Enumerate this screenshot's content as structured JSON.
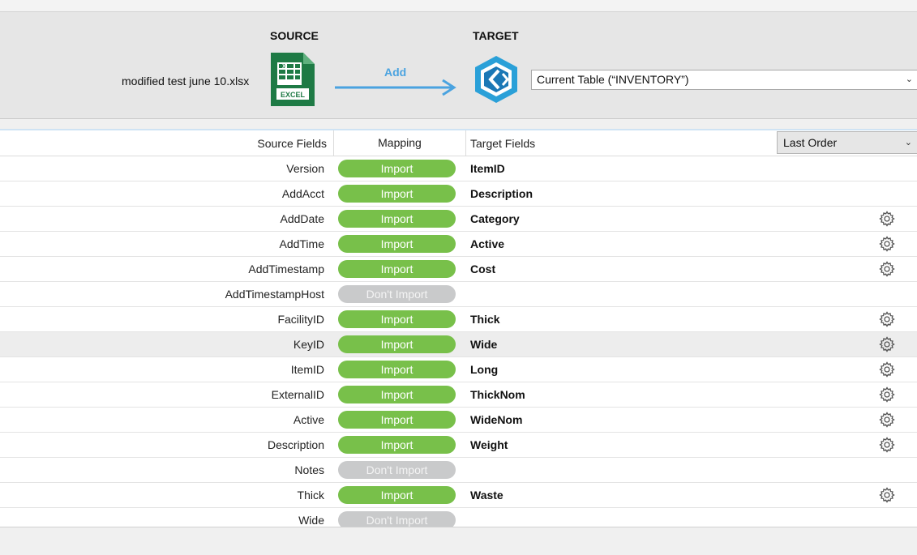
{
  "header": {
    "source_label": "SOURCE",
    "target_label": "TARGET",
    "source_file": "modified test june 10.xlsx",
    "excel_badge": "EXCEL",
    "action_label": "Add",
    "target_table": "Current Table (“INVENTORY”)"
  },
  "columns": {
    "source": "Source Fields",
    "mapping": "Mapping",
    "target": "Target Fields",
    "order": "Last Order"
  },
  "rows": [
    {
      "source": "Version",
      "mapping": "Import",
      "target": "ItemID",
      "gear": false
    },
    {
      "source": "AddAcct",
      "mapping": "Import",
      "target": "Description",
      "gear": false
    },
    {
      "source": "AddDate",
      "mapping": "Import",
      "target": "Category",
      "gear": true
    },
    {
      "source": "AddTime",
      "mapping": "Import",
      "target": "Active",
      "gear": true
    },
    {
      "source": "AddTimestamp",
      "mapping": "Import",
      "target": "Cost",
      "gear": true
    },
    {
      "source": "AddTimestampHost",
      "mapping": "Don't Import",
      "target": "",
      "gear": false
    },
    {
      "source": "FacilityID",
      "mapping": "Import",
      "target": "Thick",
      "gear": true
    },
    {
      "source": "KeyID",
      "mapping": "Import",
      "target": "Wide",
      "gear": true
    },
    {
      "source": "ItemID",
      "mapping": "Import",
      "target": "Long",
      "gear": true
    },
    {
      "source": "ExternalID",
      "mapping": "Import",
      "target": "ThickNom",
      "gear": true
    },
    {
      "source": "Active",
      "mapping": "Import",
      "target": "WideNom",
      "gear": true
    },
    {
      "source": "Description",
      "mapping": "Import",
      "target": "Weight",
      "gear": true
    },
    {
      "source": "Notes",
      "mapping": "Don't Import",
      "target": "",
      "gear": false
    },
    {
      "source": "Thick",
      "mapping": "Import",
      "target": "Waste",
      "gear": true
    },
    {
      "source": "Wide",
      "mapping": "Don't Import",
      "target": "",
      "gear": false
    },
    {
      "source": "",
      "mapping": "",
      "target": "",
      "gear": true
    }
  ],
  "colors": {
    "import": "#78c04a",
    "dont_import": "#c9cacb",
    "accent": "#4aa3e0"
  }
}
